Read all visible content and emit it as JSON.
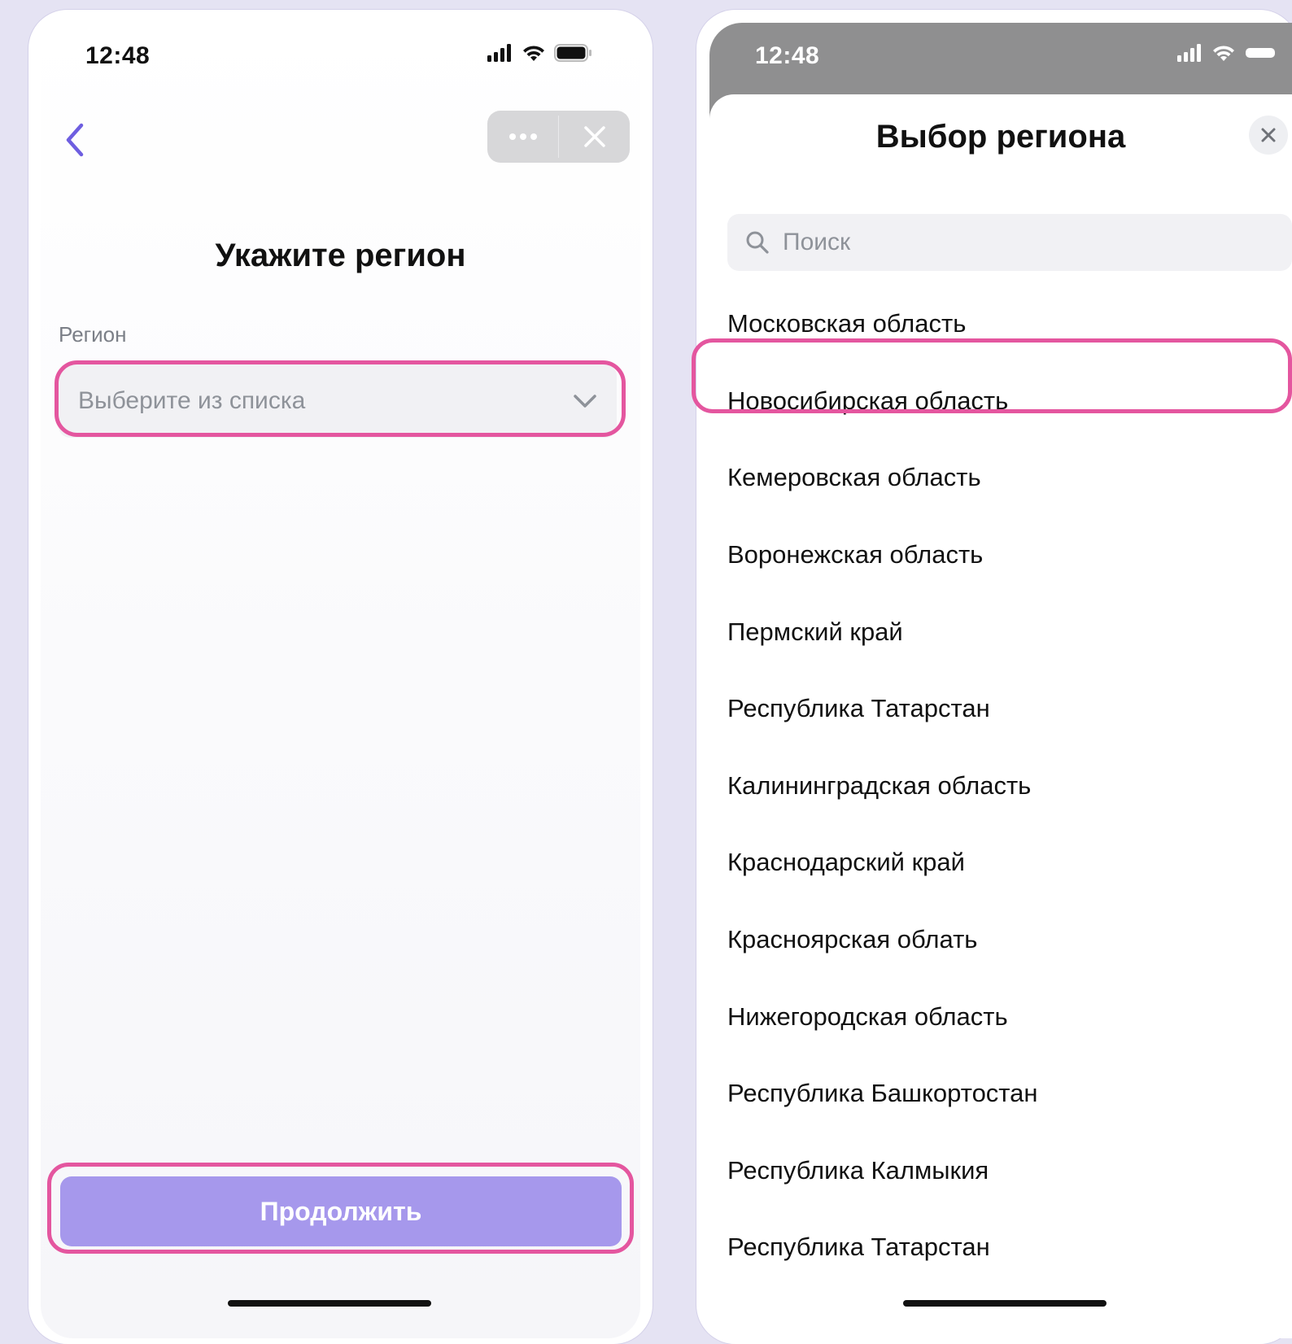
{
  "left_screen": {
    "status_time": "12:48",
    "page_title": "Укажите регион",
    "field_label": "Регион",
    "select_placeholder": "Выберите из списка",
    "continue_label": "Продолжить"
  },
  "right_screen": {
    "status_time": "12:48",
    "sheet_title": "Выбор региона",
    "search_placeholder": "Поиск",
    "regions": [
      "Московская область",
      "Новосибирская область",
      "Кемеровская область",
      "Воронежская область",
      "Пермский край",
      "Республика Татарстан",
      "Калининградская область",
      "Краснодарский край",
      "Красноярская облать",
      "Нижегородская область",
      "Республика Башкортостан",
      "Республика Калмыкия",
      "Республика Татарстан"
    ],
    "highlighted_region": "Новосибирская область"
  },
  "colors": {
    "accent": "#6e5ee0",
    "button_fill": "#a698ec",
    "highlight": "#e4569f",
    "background": "#e5e3f3"
  },
  "icons": [
    "signal-icon",
    "wifi-icon",
    "battery-icon",
    "back-chevron-icon",
    "more-dots-icon",
    "close-icon",
    "chevron-down-icon",
    "search-icon"
  ]
}
